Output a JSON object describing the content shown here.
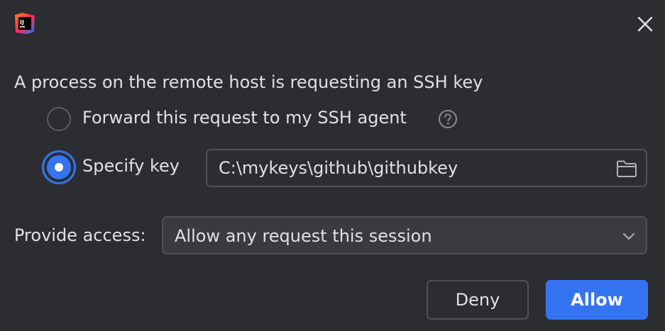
{
  "dialog": {
    "app_icon": "intellij-idea-logo",
    "app_icon_text": "IJ",
    "close_icon": "close-icon"
  },
  "prompt": "A process on the remote host is requesting an SSH key",
  "options": {
    "forward": {
      "label": "Forward this request to my SSH agent",
      "selected": false,
      "help_icon": "help-icon"
    },
    "specify": {
      "label": "Specify key",
      "selected": true,
      "path_value": "C:\\mykeys\\github\\githubkey",
      "browse_icon": "folder-icon"
    }
  },
  "access": {
    "label": "Provide access:",
    "selected": "Allow any request this session",
    "dropdown_icon": "chevron-down-icon"
  },
  "buttons": {
    "deny": "Deny",
    "allow": "Allow"
  },
  "colors": {
    "background": "#2b2d30",
    "accent": "#3574f0",
    "text": "#dfe1e5",
    "border": "#4e5157"
  }
}
